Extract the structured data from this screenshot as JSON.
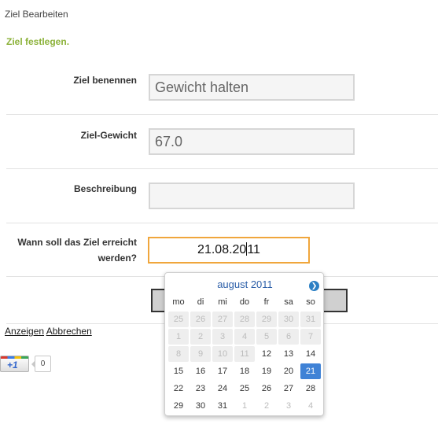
{
  "page": {
    "title": "Ziel Bearbeiten",
    "subtitle": "Ziel festlegen."
  },
  "form": {
    "name": {
      "label": "Ziel benennen",
      "value": "Gewicht halten"
    },
    "weight": {
      "label": "Ziel-Gewicht",
      "value": "67.0"
    },
    "description": {
      "label": "Beschreibung",
      "value": ""
    },
    "date": {
      "label_line1": "Wann soll das Ziel erreicht",
      "label_line2": "werden?",
      "value_before_caret": "21.08.20",
      "value_after_caret": "11"
    }
  },
  "links": {
    "show": "Anzeigen",
    "cancel": "Abbrechen"
  },
  "plusone": {
    "label": "+1",
    "count": "0"
  },
  "colors": {
    "accent_green": "#8cb23a",
    "focus_orange": "#f0a63c",
    "selected_blue": "#3f82d6",
    "header_blue": "#2b5ea8"
  },
  "datepicker": {
    "month_label": "august 2011",
    "next_icon": "chevron-right-icon",
    "weekdays": [
      "mo",
      "di",
      "mi",
      "do",
      "fr",
      "sa",
      "so"
    ],
    "weeks": [
      [
        {
          "d": "25",
          "s": "disabled"
        },
        {
          "d": "26",
          "s": "disabled"
        },
        {
          "d": "27",
          "s": "disabled"
        },
        {
          "d": "28",
          "s": "disabled"
        },
        {
          "d": "29",
          "s": "disabled"
        },
        {
          "d": "30",
          "s": "disabled"
        },
        {
          "d": "31",
          "s": "disabled"
        }
      ],
      [
        {
          "d": "1",
          "s": "disabled"
        },
        {
          "d": "2",
          "s": "disabled"
        },
        {
          "d": "3",
          "s": "disabled"
        },
        {
          "d": "4",
          "s": "disabled"
        },
        {
          "d": "5",
          "s": "disabled"
        },
        {
          "d": "6",
          "s": "disabled"
        },
        {
          "d": "7",
          "s": "disabled"
        }
      ],
      [
        {
          "d": "8",
          "s": "disabled"
        },
        {
          "d": "9",
          "s": "disabled"
        },
        {
          "d": "10",
          "s": "disabled"
        },
        {
          "d": "11",
          "s": "disabled"
        },
        {
          "d": "12",
          "s": "normal"
        },
        {
          "d": "13",
          "s": "normal"
        },
        {
          "d": "14",
          "s": "normal"
        }
      ],
      [
        {
          "d": "15",
          "s": "normal"
        },
        {
          "d": "16",
          "s": "normal"
        },
        {
          "d": "17",
          "s": "normal"
        },
        {
          "d": "18",
          "s": "normal"
        },
        {
          "d": "19",
          "s": "normal"
        },
        {
          "d": "20",
          "s": "normal"
        },
        {
          "d": "21",
          "s": "selected"
        }
      ],
      [
        {
          "d": "22",
          "s": "normal"
        },
        {
          "d": "23",
          "s": "normal"
        },
        {
          "d": "24",
          "s": "normal"
        },
        {
          "d": "25",
          "s": "normal"
        },
        {
          "d": "26",
          "s": "normal"
        },
        {
          "d": "27",
          "s": "normal"
        },
        {
          "d": "28",
          "s": "normal"
        }
      ],
      [
        {
          "d": "29",
          "s": "normal"
        },
        {
          "d": "30",
          "s": "normal"
        },
        {
          "d": "31",
          "s": "normal"
        },
        {
          "d": "1",
          "s": "muted"
        },
        {
          "d": "2",
          "s": "muted"
        },
        {
          "d": "3",
          "s": "muted"
        },
        {
          "d": "4",
          "s": "muted"
        }
      ]
    ]
  }
}
